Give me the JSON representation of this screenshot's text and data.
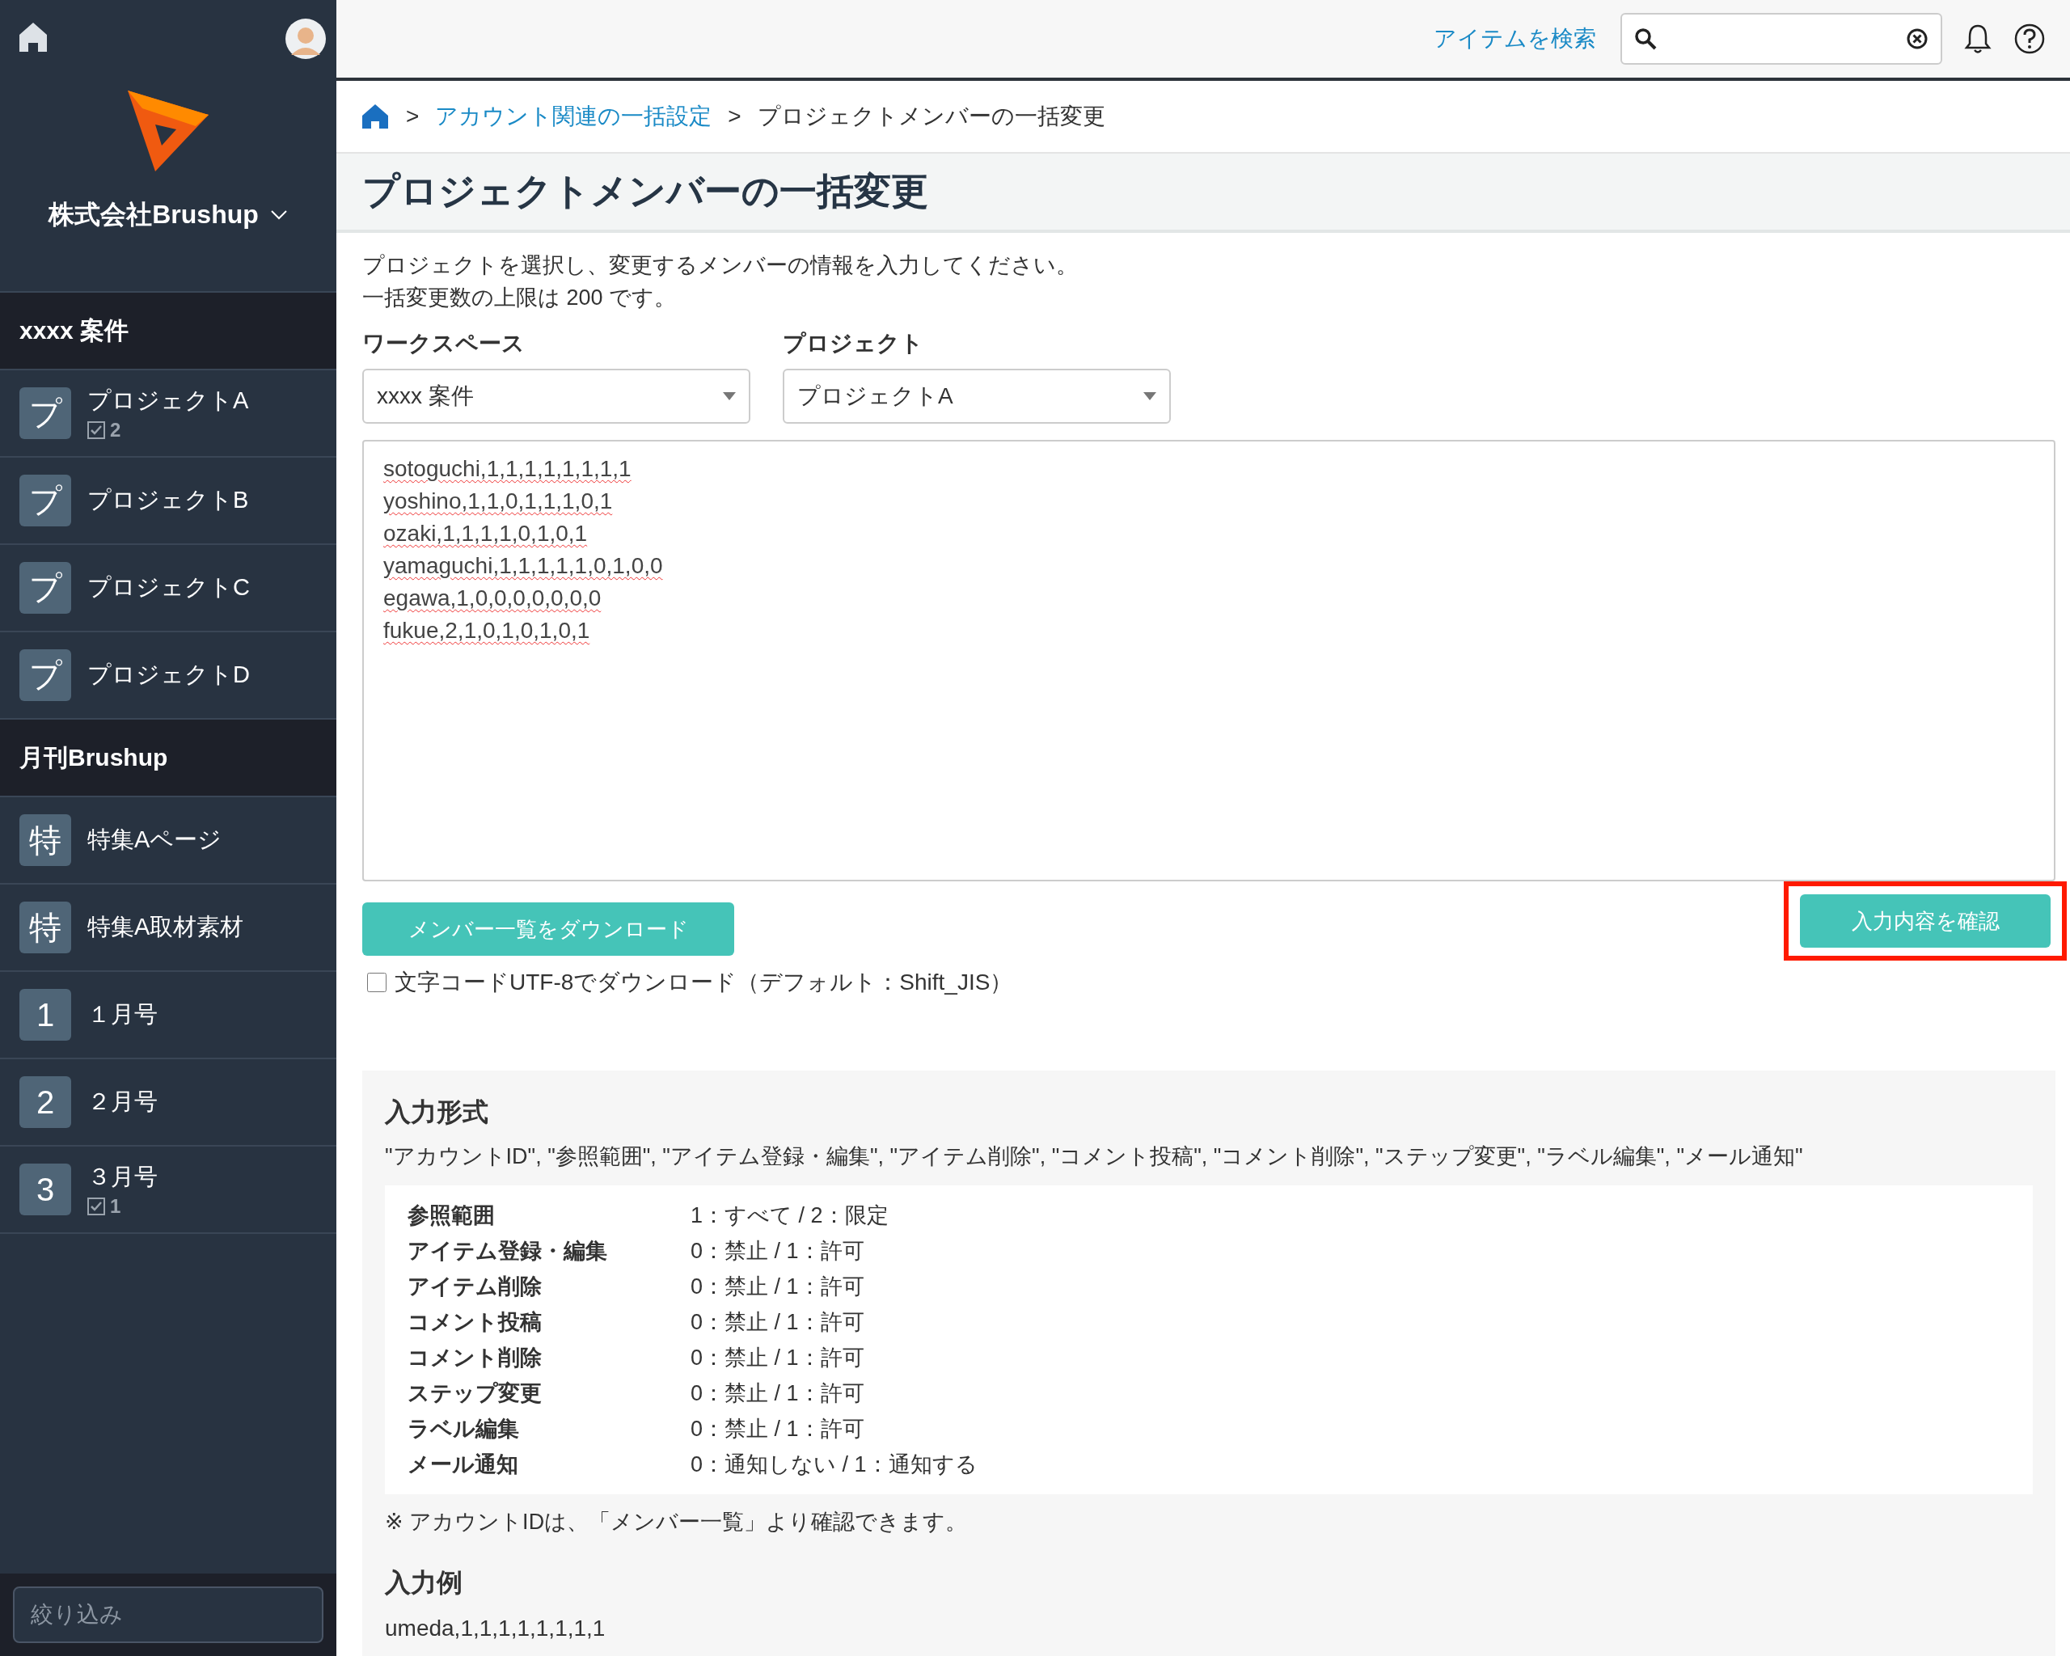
{
  "sidebar": {
    "company": "株式会社Brushup",
    "groups": [
      {
        "title": "xxxx 案件",
        "items": [
          {
            "icon": "プ",
            "label": "プロジェクトA",
            "count": "2"
          },
          {
            "icon": "プ",
            "label": "プロジェクトB"
          },
          {
            "icon": "プ",
            "label": "プロジェクトC"
          },
          {
            "icon": "プ",
            "label": "プロジェクトD"
          }
        ]
      },
      {
        "title": "月刊Brushup",
        "items": [
          {
            "icon": "特",
            "label": "特集Aページ"
          },
          {
            "icon": "特",
            "label": "特集A取材素材"
          },
          {
            "icon": "1",
            "label": "１月号"
          },
          {
            "icon": "2",
            "label": "２月号"
          },
          {
            "icon": "3",
            "label": "３月号",
            "count": "1"
          }
        ]
      }
    ],
    "filter": {
      "placeholder": "絞り込み"
    }
  },
  "header": {
    "search_link": "アイテムを検索"
  },
  "breadcrumb": [
    {
      "separator": ">",
      "label": "アカウント関連の一括設定",
      "link": true
    },
    {
      "separator": ">",
      "label": "プロジェクトメンバーの一括変更",
      "link": false
    }
  ],
  "page": {
    "title": "プロジェクトメンバーの一括変更",
    "description": [
      "プロジェクトを選択し、変更するメンバーの情報を入力してください。",
      "一括変更数の上限は 200 です。"
    ],
    "selects": [
      {
        "label": "ワークスペース",
        "value": "xxxx 案件"
      },
      {
        "label": "プロジェクト",
        "value": "プロジェクトA"
      }
    ],
    "textarea": {
      "lines": [
        "sotoguchi,1,1,1,1,1,1,1,1",
        "yoshino,1,1,0,1,1,1,0,1",
        "ozaki,1,1,1,1,0,1,0,1",
        "yamaguchi,1,1,1,1,1,0,1,0,0",
        "egawa,1,0,0,0,0,0,0,0",
        "fukue,2,1,0,1,0,1,0,1"
      ]
    },
    "download_button": "メンバー一覧をダウンロード",
    "confirm_button": {
      "label": "入力内容を確認",
      "highlighted": true
    },
    "checkbox": {
      "label": "文字コードUTF-8でダウンロード（デフォルト：Shift_JIS）",
      "checked": false
    },
    "format": {
      "heading": "入力形式",
      "fields": "\"アカウントID\", \"参照範囲\", \"アイテム登録・編集\", \"アイテム削除\", \"コメント投稿\", \"コメント削除\", \"ステップ変更\", \"ラベル編集\", \"メール通知\"",
      "rows": [
        {
          "name": "参照範囲",
          "desc": "1：すべて / 2：限定"
        },
        {
          "name": "アイテム登録・編集",
          "desc": "0：禁止 / 1：許可"
        },
        {
          "name": "アイテム削除",
          "desc": "0：禁止 / 1：許可"
        },
        {
          "name": "コメント投稿",
          "desc": "0：禁止 / 1：許可"
        },
        {
          "name": "コメント削除",
          "desc": "0：禁止 / 1：許可"
        },
        {
          "name": "ステップ変更",
          "desc": "0：禁止 / 1：許可"
        },
        {
          "name": "ラベル編集",
          "desc": "0：禁止 / 1：許可"
        },
        {
          "name": "メール通知",
          "desc": "0：通知しない / 1：通知する"
        }
      ],
      "note": "※ アカウントIDは、「メンバー一覧」より確認できます。",
      "example_heading": "入力例",
      "example_lines": [
        "umeda,1,1,1,1,1,1,1,1"
      ]
    }
  }
}
